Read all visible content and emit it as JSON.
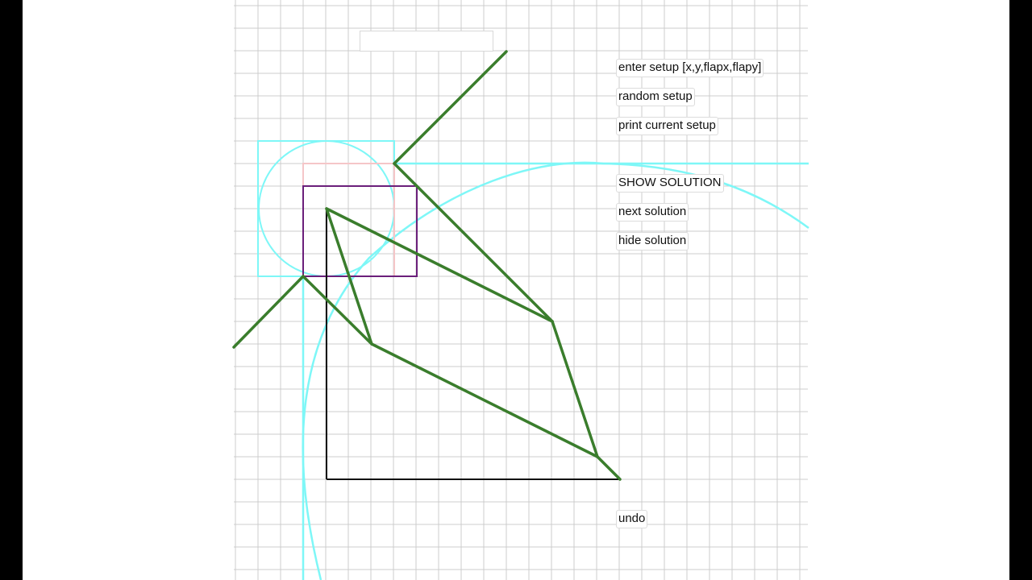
{
  "setup": {
    "input_value": "",
    "input_placeholder": ""
  },
  "buttons": {
    "enter_setup": "enter setup [x,y,flapx,flapy]",
    "random_setup": "random setup",
    "print_setup": "print current setup",
    "show_solution": "SHOW SOLUTION",
    "next_solution": "next solution",
    "hide_solution": "hide solution",
    "undo": "undo"
  },
  "colors": {
    "grid": "#cccccc",
    "guide": "#7ef7f7",
    "crease": "#3a7d2c",
    "target_box": "#6b1f7a",
    "flap_box": "#f5c6c8",
    "base_edge": "#111111"
  }
}
